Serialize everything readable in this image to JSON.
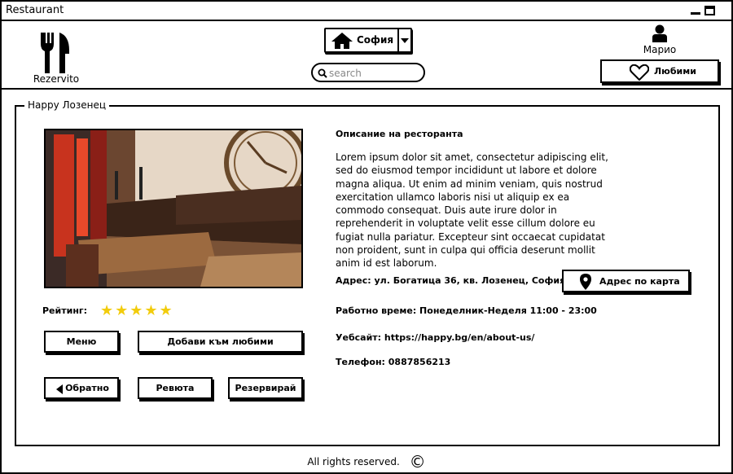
{
  "window": {
    "title": "Restaurant"
  },
  "header": {
    "logo_text": "Rezervito",
    "city": "София",
    "search_placeholder": "search",
    "user_name": "Марио",
    "favorites_label": "Любими"
  },
  "restaurant": {
    "name": "Happy Лозенец",
    "rating_label": "Рейтинг:",
    "rating": 5,
    "rating_stars": "★★★★★",
    "description_title": "Описание на ресторанта",
    "description": "Lorem ipsum dolor sit amet, consectetur adipiscing elit, sed do eiusmod tempor incididunt ut labore et dolore magna aliqua. Ut enim ad minim veniam, quis nostrud exercitation ullamco laboris nisi ut aliquip ex ea commodo consequat. Duis aute irure dolor in reprehenderit in voluptate velit esse cillum dolore eu fugiat nulla pariatur. Excepteur sint occaecat cupidatat non proident, sunt in culpa qui officia deserunt mollit anim id est laborum.",
    "address": "Адрес:  ул. Богатица 36, кв. Лозенец, София",
    "hours": "Работно време: Понеделник-Неделя 11:00 - 23:00",
    "website": "Уебсайт: https://happy.bg/en/about-us/",
    "phone": "Телефон: 0887856213"
  },
  "buttons": {
    "menu": "Меню",
    "add_favorite": "Добави към любими",
    "back": "Обратно",
    "reviews": "Ревюта",
    "reserve": "Резервирай",
    "map": "Адрес по карта"
  },
  "footer": {
    "text": "All rights reserved.",
    "copyright_symbol": "©"
  },
  "colors": {
    "star": "#f2cc0c",
    "border": "#000000"
  }
}
